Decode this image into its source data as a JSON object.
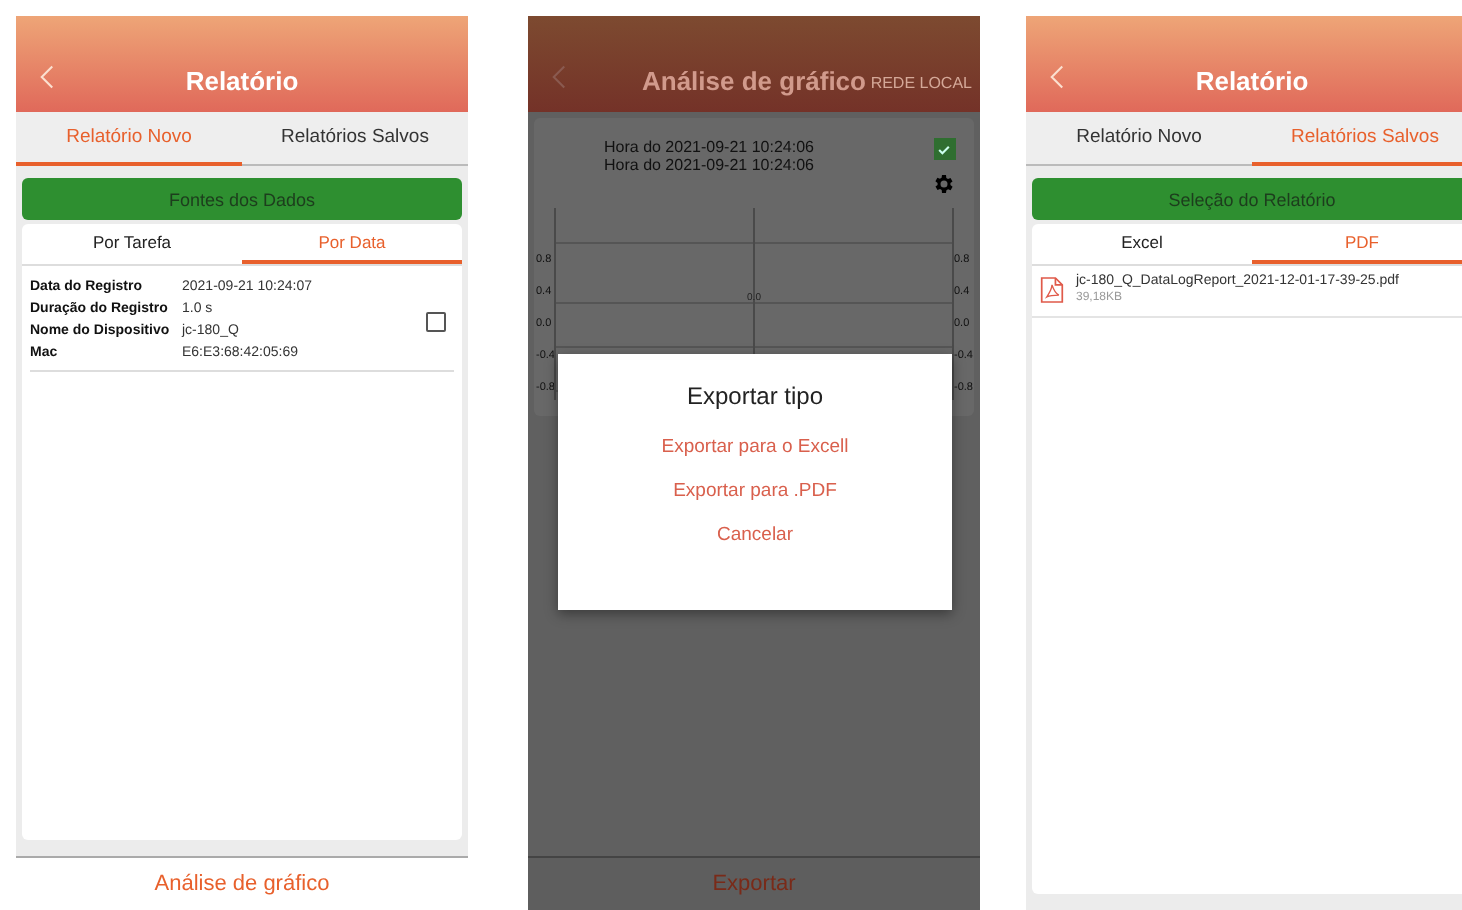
{
  "screens": [
    {
      "kind": "report",
      "title": "Relatório",
      "tabs": [
        {
          "label": "Relatório Novo",
          "selected": true
        },
        {
          "label": "Relatórios Salvos",
          "selected": false
        }
      ],
      "source_button": "Fontes dos Dados",
      "subtabs": [
        {
          "label": "Por Tarefa",
          "selected": false
        },
        {
          "label": "Por Data",
          "selected": true
        }
      ],
      "records": [
        {
          "checked": false,
          "fields": [
            {
              "label": "Data do Registro",
              "value": "2021-09-21 10:24:07"
            },
            {
              "label": "Duração do Registro",
              "value": "1.0 s"
            },
            {
              "label": "Nome do Dispositivo",
              "value": "jc-180_Q"
            },
            {
              "label": "Mac",
              "value": "E6:E3:68:42:05:69"
            }
          ]
        }
      ],
      "bottom_action": "Análise de gráfico"
    },
    {
      "kind": "chart",
      "title": "Análise de gráfico",
      "right_action": "REDE LOCAL",
      "times": [
        "Hora do 2021-09-21 10:24:06",
        "Hora do 2021-09-21 10:24:06"
      ],
      "show_checked": true,
      "left_ticks": [
        "0.8",
        "0.4",
        "0.0",
        "-0.4",
        "-0.8"
      ],
      "right_ticks": [
        "0.8",
        "0.4",
        "0.0",
        "-0.4",
        "-0.8"
      ],
      "center_label": "0.0",
      "dialog": {
        "title": "Exportar tipo",
        "options": [
          "Exportar para o Excell",
          "Exportar para .PDF",
          "Cancelar"
        ]
      },
      "bottom_action": "Exportar"
    },
    {
      "kind": "saved",
      "title": "Relatório",
      "tabs": [
        {
          "label": "Relatório Novo",
          "selected": false
        },
        {
          "label": "Relatórios Salvos",
          "selected": true
        }
      ],
      "source_button": "Seleção do Relatório",
      "subtabs": [
        {
          "label": "Excel",
          "selected": false
        },
        {
          "label": "PDF",
          "selected": true
        }
      ],
      "files": [
        {
          "name": "jc-180_Q_DataLogReport_2021-12-01-17-39-25.pdf",
          "size": "39,18KB"
        }
      ]
    }
  ]
}
